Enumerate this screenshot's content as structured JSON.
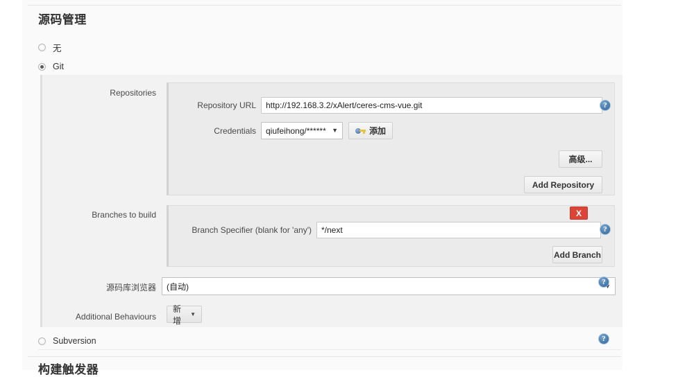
{
  "section": {
    "title": "源码管理",
    "next_section_title": "构建触发器"
  },
  "scm_options": [
    {
      "label": "无",
      "selected": false
    },
    {
      "label": "Git",
      "selected": true
    },
    {
      "label": "Subversion",
      "selected": false
    }
  ],
  "git": {
    "repositories": {
      "label": "Repositories",
      "repository_url": {
        "label": "Repository URL",
        "value": "http://192.168.3.2/xAlert/ceres-cms-vue.git"
      },
      "credentials": {
        "label": "Credentials",
        "value": "qiufeihong/******",
        "add_button_label": "添加",
        "add_button_icon": "key-icon"
      },
      "advanced_button_label": "高级...",
      "add_repository_button_label": "Add Repository"
    },
    "branches": {
      "label": "Branches to build",
      "branch_specifier": {
        "label": "Branch Specifier (blank for 'any')",
        "value": "*/next"
      },
      "delete_button_label": "X",
      "add_branch_button_label": "Add Branch"
    },
    "repository_browser": {
      "label": "源码库浏览器",
      "value": "(自动)"
    },
    "additional_behaviours": {
      "label": "Additional Behaviours",
      "add_button_label": "新增",
      "caret": "▼"
    }
  },
  "icons": {
    "help": "?",
    "select_caret": "▼"
  },
  "colors": {
    "danger": "#dc4437",
    "help_blue": "#4c7fb0",
    "panel_bg": "#f2f2f2",
    "subpanel_bg": "#ebebeb",
    "page_bg": "#fafafa"
  }
}
